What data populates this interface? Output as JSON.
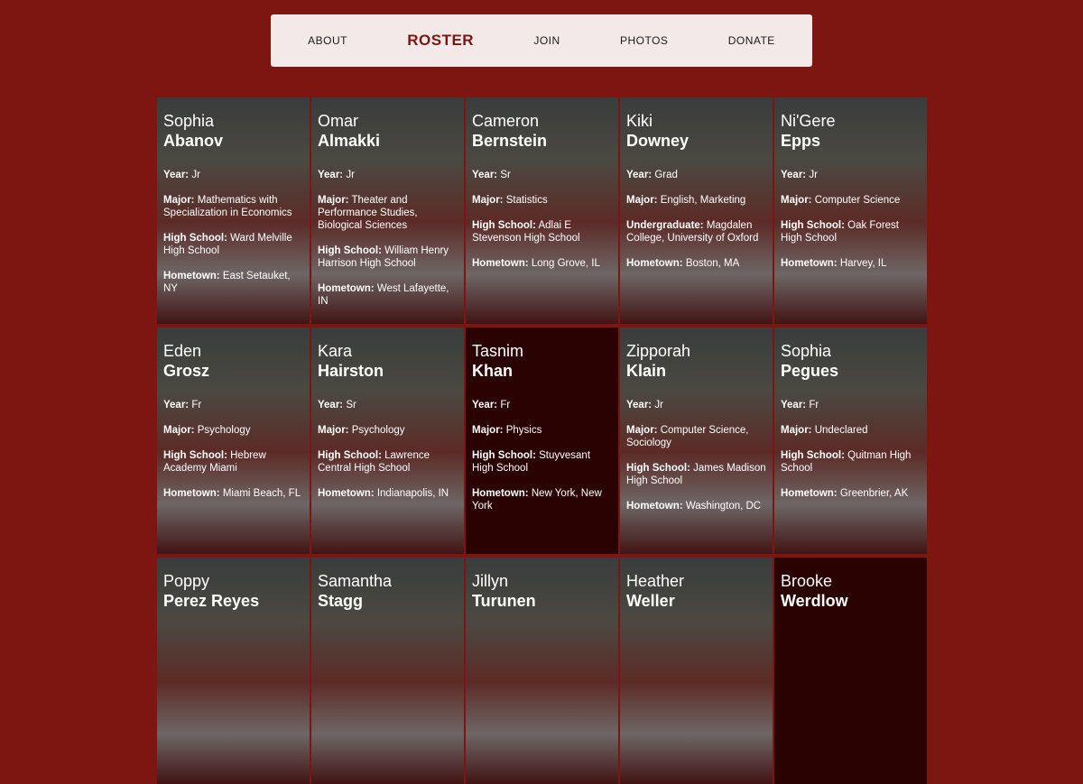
{
  "nav": [
    {
      "label": "ABOUT",
      "active": false
    },
    {
      "label": "ROSTER",
      "active": true
    },
    {
      "label": "JOIN",
      "active": false
    },
    {
      "label": "PHOTOS",
      "active": false
    },
    {
      "label": "DONATE",
      "active": false
    }
  ],
  "field_labels": {
    "year": "Year:",
    "major": "Major:",
    "high_school": "High School:",
    "undergraduate": "Undergraduate:",
    "hometown": "Hometown:"
  },
  "roster": [
    {
      "first": "Sophia",
      "last": "Abanov",
      "photo": true,
      "year": "Jr",
      "major": "Mathematics with Specialization in Economics",
      "school_key": "high_school",
      "school": "Ward Melville High School",
      "hometown": "East Setauket, NY"
    },
    {
      "first": "Omar",
      "last": "Almakki",
      "photo": true,
      "year": "Jr",
      "major": "Theater and Performance Studies, Biological Sciences",
      "school_key": "high_school",
      "school": "William Henry Harrison High School",
      "hometown": "West Lafayette, IN"
    },
    {
      "first": "Cameron",
      "last": "Bernstein",
      "photo": true,
      "year": "Sr",
      "major": "Statistics",
      "school_key": "high_school",
      "school": "Adlai E Stevenson High School",
      "hometown": "Long Grove, IL"
    },
    {
      "first": "Kiki",
      "last": "Downey",
      "photo": true,
      "year": "Grad",
      "major": "English, Marketing",
      "school_key": "undergraduate",
      "school": "Magdalen College, University of Oxford",
      "hometown": "Boston, MA"
    },
    {
      "first": "Ni'Gere",
      "last": "Epps",
      "photo": true,
      "year": "Jr",
      "major": "Computer Science",
      "school_key": "high_school",
      "school": "Oak Forest High School",
      "hometown": "Harvey, IL"
    },
    {
      "first": "Eden",
      "last": "Grosz",
      "photo": true,
      "year": "Fr",
      "major": "Psychology",
      "school_key": "high_school",
      "school": "Hebrew Academy Miami",
      "hometown": "Miami Beach, FL"
    },
    {
      "first": "Kara",
      "last": "Hairston",
      "photo": true,
      "year": "Sr",
      "major": "Psychology",
      "school_key": "high_school",
      "school": "Lawrence Central High School",
      "hometown": "Indianapolis, IN"
    },
    {
      "first": "Tasnim",
      "last": "Khan",
      "photo": false,
      "year": "Fr",
      "major": "Physics",
      "school_key": "high_school",
      "school": "Stuyvesant High School",
      "hometown": "New York, New York"
    },
    {
      "first": "Zipporah",
      "last": "Klain",
      "photo": true,
      "year": "Jr",
      "major": "Computer Science, Sociology",
      "school_key": "high_school",
      "school": "James Madison High School",
      "hometown": "Washington, DC"
    },
    {
      "first": "Sophia",
      "last": "Pegues",
      "photo": true,
      "year": "Fr",
      "major": "Undeclared",
      "school_key": "high_school",
      "school": "Quitman High School",
      "hometown": "Greenbrier, AK"
    },
    {
      "first": "Poppy",
      "last": "Perez Reyes",
      "photo": true
    },
    {
      "first": "Samantha",
      "last": "Stagg",
      "photo": true
    },
    {
      "first": "Jillyn",
      "last": "Turunen",
      "photo": true
    },
    {
      "first": "Heather",
      "last": "Weller",
      "photo": true
    },
    {
      "first": "Brooke",
      "last": "Werdlow",
      "photo": false
    }
  ]
}
